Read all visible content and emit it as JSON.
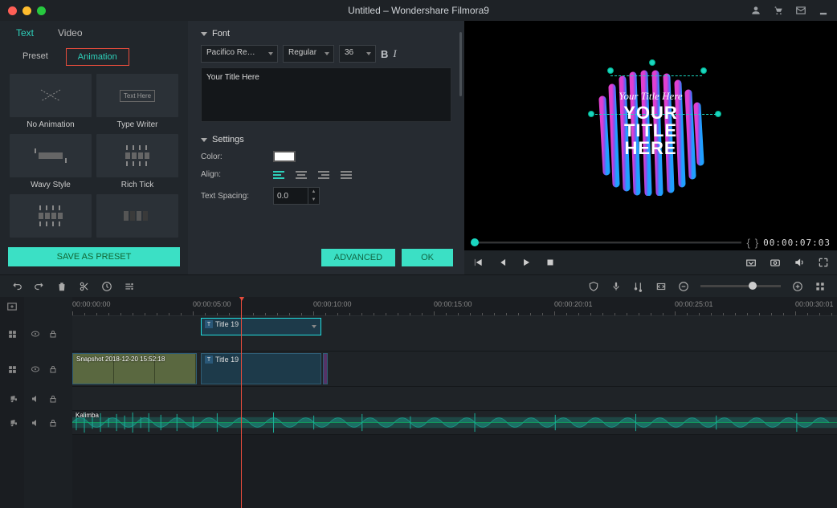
{
  "window": {
    "title": "Untitled – Wondershare Filmora9"
  },
  "tabs": {
    "text": "Text",
    "video": "Video"
  },
  "subtabs": {
    "preset": "Preset",
    "animation": "Animation"
  },
  "presets": [
    {
      "label": "No Animation"
    },
    {
      "label": "Type Writer"
    },
    {
      "label": "Wavy Style"
    },
    {
      "label": "Rich Tick"
    },
    {
      "label": ""
    },
    {
      "label": ""
    }
  ],
  "save_as_preset": "SAVE AS PRESET",
  "font": {
    "section": "Font",
    "family": "Pacifico Re…",
    "weight": "Regular",
    "size": "36",
    "textarea": "Your Title Here"
  },
  "settings": {
    "section": "Settings",
    "color_label": "Color:",
    "align_label": "Align:",
    "spacing_label": "Text Spacing:",
    "spacing_value": "0.0"
  },
  "buttons": {
    "advanced": "ADVANCED",
    "ok": "OK"
  },
  "preview": {
    "curved_text": "Your Title Here",
    "main_text_l1": "YOUR",
    "main_text_l2": "TITLE",
    "main_text_l3": "HERE",
    "timecode": "00:00:07:03"
  },
  "timeline": {
    "marks": [
      "00:00:00:00",
      "00:00:05:00",
      "00:00:10:00",
      "00:00:15:00",
      "00:00:20:01",
      "00:00:25:01",
      "00:00:30:01"
    ],
    "clips": {
      "title1": "Title 19",
      "title2": "Title 19",
      "video_label": "Snapshot 2018-12-20 15:52:18",
      "audio_label": "Kalimba"
    }
  }
}
